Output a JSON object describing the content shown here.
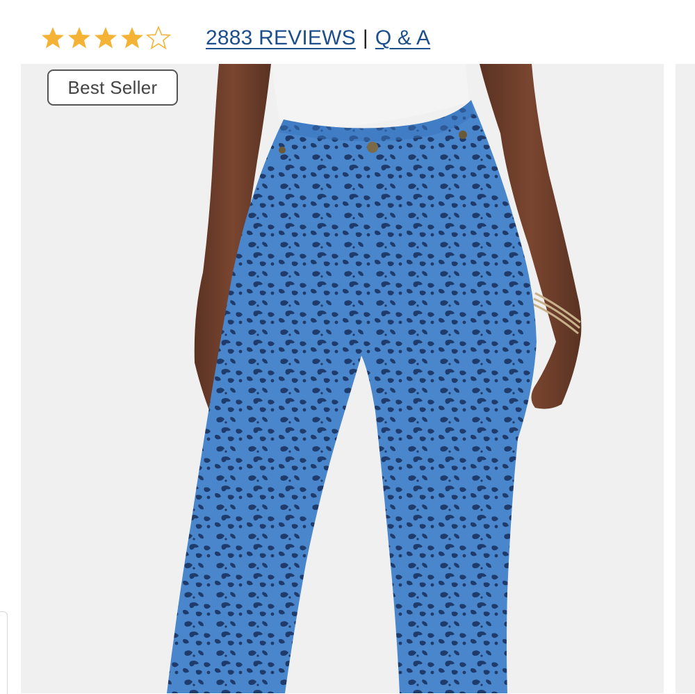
{
  "rating": {
    "value": 4,
    "max": 5,
    "star_color": "#f5b335",
    "empty_star_color": "#f5b335"
  },
  "reviews": {
    "count_label": "2883 REVIEWS",
    "separator": "|",
    "qa_label": "Q & A",
    "link_color": "#1d4f8c"
  },
  "product": {
    "badge_label": "Best Seller",
    "image_icon": "leopard-print-jeans-photo",
    "print_color": "#3f7fc8",
    "spot_color": "#1e3b6b",
    "top_color": "#f4f4f4"
  }
}
